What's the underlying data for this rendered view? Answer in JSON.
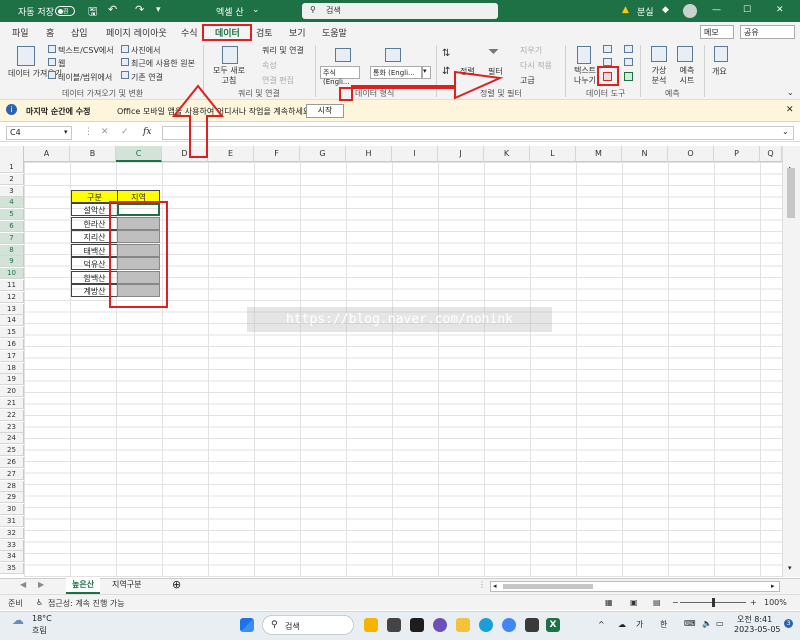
{
  "titlebar": {
    "autosave_label": "자동 저장",
    "autosave_state": "끔",
    "filename": "엑셀 산",
    "search_placeholder": "검색",
    "user": "분실"
  },
  "tabs": [
    "파일",
    "홈",
    "삽입",
    "페이지 레이아웃",
    "수식",
    "데이터",
    "검토",
    "보기",
    "도움말"
  ],
  "active_tab": "데이터",
  "memo_label": "메모",
  "share_label": "공유",
  "ribbon": {
    "get_data": "데이터 가져오기",
    "from_text_csv": "텍스트/CSV에서",
    "from_web": "웹",
    "from_table": "테이블/범위에서",
    "from_picture": "사진에서",
    "recent_sources": "최근에 사용한 원본",
    "existing_connections": "기존 연결",
    "group_get_transform": "데이터 가져오기 및 변환",
    "refresh_all": "모두 새로 고침",
    "queries_connections": "쿼리 및 연결",
    "properties": "속성",
    "edit_links": "연결 편집",
    "group_queries": "쿼리 및 연결",
    "stocks": "주식 (Engli...",
    "currency": "통화 (Engli...",
    "group_data_types": "데이터 형식",
    "sort": "정렬",
    "filter": "필터",
    "clear": "지우기",
    "reapply": "다시 적용",
    "advanced": "고급",
    "group_sort_filter": "정렬 및 필터",
    "text_to_columns": "텍스트 나누기",
    "group_data_tools": "데이터 도구",
    "what_if": "가상 분석",
    "forecast_sheet": "예측 시트",
    "group_forecast": "예측",
    "outline": "개요"
  },
  "message_bar": {
    "title": "마지막 순간에 수정",
    "text": "Office 모바일 앱을 사용하여 어디서나 작업을 계속하세요.",
    "button": "시작"
  },
  "formula_bar": {
    "name_box": "C4",
    "formula": ""
  },
  "columns": [
    "A",
    "B",
    "C",
    "D",
    "E",
    "F",
    "G",
    "H",
    "I",
    "J",
    "K",
    "L",
    "M",
    "N",
    "O",
    "P",
    "Q"
  ],
  "rows": [
    "1",
    "2",
    "3",
    "4",
    "5",
    "6",
    "7",
    "8",
    "9",
    "10",
    "11",
    "12",
    "13",
    "14",
    "15",
    "16",
    "17",
    "18",
    "19",
    "20",
    "21",
    "22",
    "23",
    "24",
    "25",
    "26",
    "27",
    "28",
    "29",
    "30",
    "31",
    "32",
    "33",
    "34",
    "35"
  ],
  "table": {
    "header_name": "구분",
    "header_region": "지역",
    "mountains": [
      "설악산",
      "한라산",
      "지리산",
      "태백산",
      "덕유산",
      "함백산",
      "계방산"
    ]
  },
  "watermark": "https://blog.naver.com/nohink",
  "sheets": [
    "높은산",
    "지역구분"
  ],
  "active_sheet": "높은산",
  "status": {
    "ready": "준비",
    "accessibility": "접근성: 계속 진행 가능",
    "zoom": "100%"
  },
  "taskbar": {
    "weather_temp": "18°C",
    "weather_desc": "흐림",
    "search": "검색",
    "time": "오전 8:41",
    "date": "2023-05-05",
    "ime1": "가",
    "ime2": "한"
  },
  "colors": {
    "excel_green": "#1e7145",
    "highlight_red": "#e02020",
    "header_yellow": "#ffff00",
    "selected_gray": "#bfbfbf"
  }
}
